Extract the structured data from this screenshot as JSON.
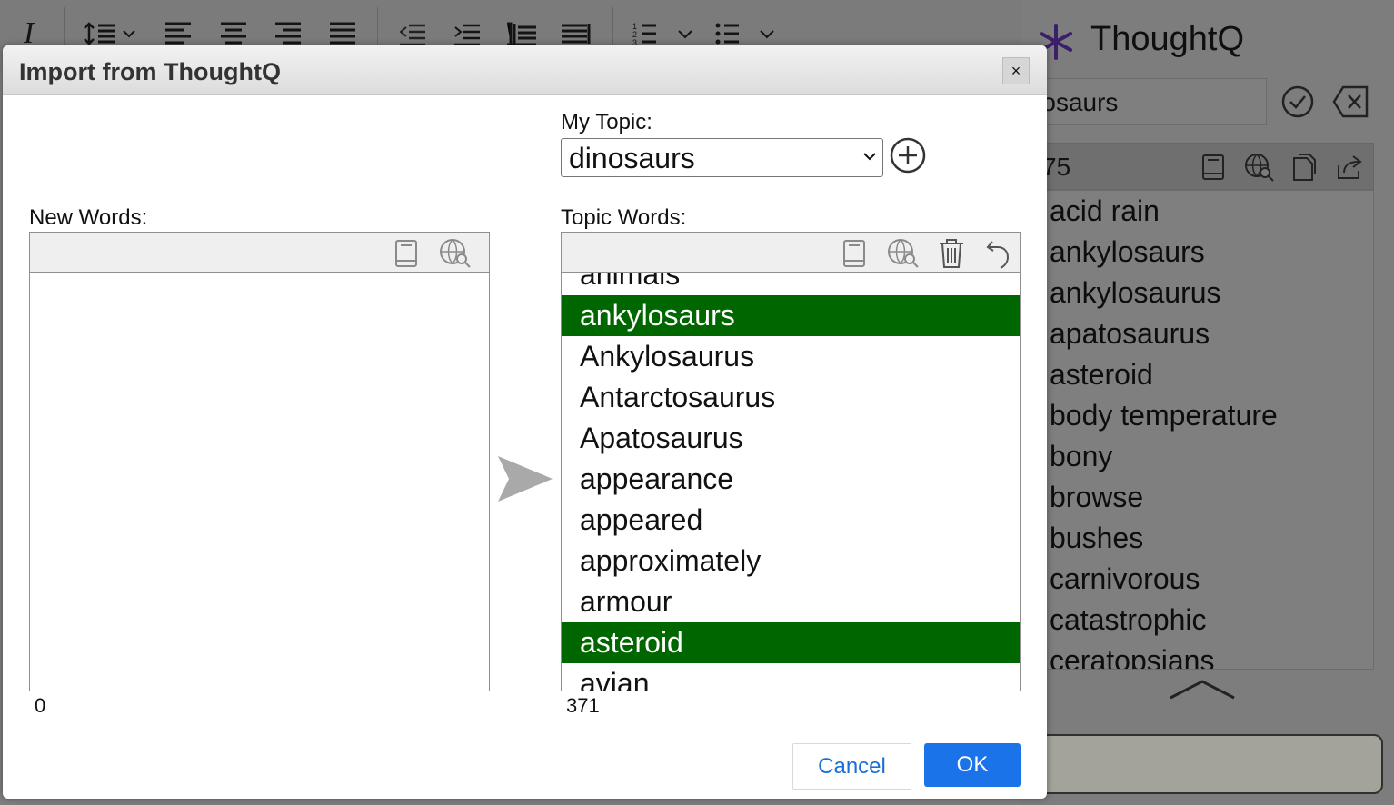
{
  "editor_toolbar": {
    "icons": [
      "italic-icon",
      "line-spacing-icon",
      "align-left-icon",
      "align-center-icon",
      "align-right-icon",
      "align-justify-icon",
      "outdent-icon",
      "indent-icon",
      "ltr-icon",
      "rtl-icon",
      "numbered-list-icon",
      "bulleted-list-icon"
    ],
    "italic_label": "I"
  },
  "thoughtq_panel": {
    "title": "ThoughtQ",
    "search_value": "dinosaurs",
    "word_count": "75",
    "words": [
      "acid rain",
      "ankylosaurs",
      "ankylosaurus",
      "apatosaurus",
      "asteroid",
      "body temperature",
      "bony",
      "browse",
      "bushes",
      "carnivorous",
      "catastrophic",
      "ceratopsians"
    ]
  },
  "dialog": {
    "title": "Import from ThoughtQ",
    "close_label": "×",
    "my_topic_label": "My Topic:",
    "topic_selected": "dinosaurs",
    "new_words_label": "New Words:",
    "topic_words_label": "Topic Words:",
    "new_words_count": "0",
    "topic_words_count": "371",
    "topic_words": [
      {
        "text": "animals",
        "selected": false
      },
      {
        "text": "ankylosaurs",
        "selected": true
      },
      {
        "text": "Ankylosaurus",
        "selected": false
      },
      {
        "text": "Antarctosaurus",
        "selected": false
      },
      {
        "text": "Apatosaurus",
        "selected": false
      },
      {
        "text": "appearance",
        "selected": false
      },
      {
        "text": "appeared",
        "selected": false
      },
      {
        "text": "approximately",
        "selected": false
      },
      {
        "text": "armour",
        "selected": false
      },
      {
        "text": "asteroid",
        "selected": true
      },
      {
        "text": "avian",
        "selected": false
      }
    ],
    "cancel_label": "Cancel",
    "ok_label": "OK",
    "selected_color": "#006600",
    "ok_color": "#1a73e8"
  }
}
